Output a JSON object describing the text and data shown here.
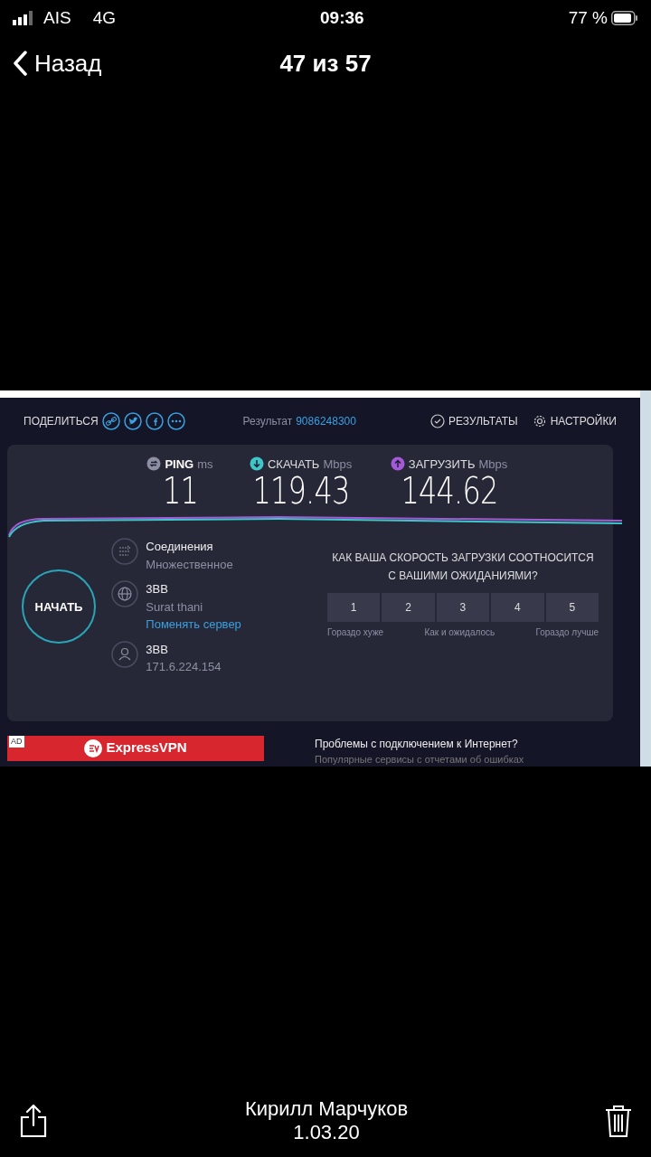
{
  "status_bar": {
    "carrier": "AIS",
    "network": "4G",
    "time": "09:36",
    "battery": "77 %"
  },
  "nav": {
    "back": "Назад",
    "title": "47 из 57"
  },
  "screenshot": {
    "share_label": "ПОДЕЛИТЬСЯ",
    "result_label": "Результат",
    "result_id": "9086248300",
    "results_link": "РЕЗУЛЬТАТЫ",
    "settings_link": "НАСТРОЙКИ",
    "metrics": [
      {
        "kind": "ping",
        "name": "PING",
        "unit": "ms",
        "value": "11"
      },
      {
        "kind": "download",
        "name": "СКАЧАТЬ",
        "unit": "Mbps",
        "value": "119.43"
      },
      {
        "kind": "upload",
        "name": "ЗАГРУЗИТЬ",
        "unit": "Mbps",
        "value": "144.62"
      }
    ],
    "start_button": "НАЧАТЬ",
    "info": [
      {
        "kind": "connections",
        "title": "Соединения",
        "subtitle": "Множественное"
      },
      {
        "kind": "server",
        "title": "3BB",
        "subtitle": "Surat thani",
        "link": "Поменять сервер"
      },
      {
        "kind": "provider",
        "title": "3BB",
        "subtitle": "171.6.224.154"
      }
    ],
    "survey": {
      "question": "КАК ВАША СКОРОСТЬ ЗАГРУЗКИ СООТНОСИТСЯ С ВАШИМИ ОЖИДАНИЯМИ?",
      "options": [
        {
          "label": "1",
          "selected": false
        },
        {
          "label": "2",
          "selected": false
        },
        {
          "label": "3",
          "selected": false
        },
        {
          "label": "4",
          "selected": false
        },
        {
          "label": "5",
          "selected": false
        }
      ],
      "scale": [
        "Гораздо хуже",
        "Как и ожидалось",
        "Гораздо лучше"
      ]
    },
    "ad": {
      "badge": "AD",
      "brand": "ExpressVPN"
    },
    "help": {
      "title": "Проблемы с подключением к Интернет?",
      "text": "Популярные сервисы с отчетами об ошибках"
    }
  },
  "footer": {
    "author": "Кирилл Марчуков",
    "date": "1.03.20"
  }
}
